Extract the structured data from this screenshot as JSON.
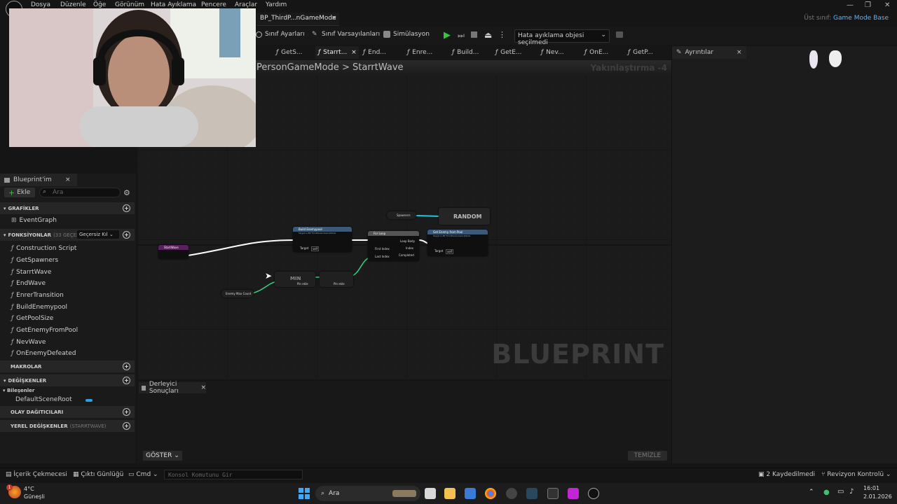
{
  "menu": [
    "Dosya",
    "Düzenle",
    "Öğe",
    "Görünüm",
    "Hata Ayıklama",
    "Pencere",
    "Araçlar",
    "Yardım"
  ],
  "doc_tab": {
    "label": "BP_ThirdP...nGameMode"
  },
  "parent_class": {
    "prefix": "Üst sınıf:",
    "name": "Game Mode Base"
  },
  "toolbar": {
    "class_settings": "Sınıf Ayarları",
    "class_defaults": "Sınıf Varsayılanları",
    "simulation": "Simülasyon",
    "debug_object": "Hata ayıklama objesi seçilmedi"
  },
  "fn_tabs": [
    "GetS...",
    "Starrt...",
    "End...",
    "Enre...",
    "Build...",
    "GetE...",
    "Nev...",
    "OnE...",
    "GetP..."
  ],
  "details_tab": "Ayrıntılar",
  "graph": {
    "breadcrumb_root": "PersonGameMode",
    "breadcrumb_sep": ">",
    "breadcrumb_leaf": "StarrtWave",
    "zoom": "Yakınlaştırma -4",
    "watermark": "BLUEPRINT",
    "nodes": {
      "start": "StartWave",
      "build": "Build Enemypool",
      "build_sub": "Target is BP ThirdPersonGameMode",
      "for_loop": "For Loop",
      "get_enemy": "Get Enemy from Pool",
      "get_enemy_sub": "Target is BP ThirdPersonGameMode",
      "spawners": "Spawners",
      "random": "RANDOM",
      "min": "MIN",
      "enemy_max_count": "Enemy Max Count",
      "pin_add": "Pin ekle",
      "target": "Target",
      "self": "self",
      "first_index": "First Index",
      "last_index": "Last Index",
      "loop_body": "Loop Body",
      "index": "Index",
      "completed": "Completed"
    }
  },
  "left_panel": {
    "tab": "Blueprint'im",
    "add": "Ekle",
    "search_placeholder": "Ara",
    "sections": {
      "graphs": "GRAFİKLER",
      "functions": "FONKSİYONLAR",
      "functions_count": "(33 GEÇERS",
      "override": "Geçersiz Kıl",
      "macros": "MAKROLAR",
      "variables": "DEĞİŞKENLER",
      "components": "Bileşenler",
      "dispatchers": "OLAY DAĞITICILARI",
      "local_vars": "YEREL DEĞİŞKENLER",
      "local_vars_scope": "(STARRTWAVE)"
    },
    "event_graph": "EventGraph",
    "functions": [
      "Construction Script",
      "GetSpawners",
      "StarrtWave",
      "EndWave",
      "EnrerTransition",
      "BuildEnemypool",
      "GetPoolSize",
      "GetEnemyFromPool",
      "NevWave",
      "OnEnemyDefeated"
    ],
    "component_item": "DefaultSceneRoot"
  },
  "compiler": {
    "tab": "Derleyici Sonuçları",
    "show": "GÖSTER",
    "clear": "TEMİZLE"
  },
  "statusbar": {
    "content_drawer": "İçerik Çekmecesi",
    "output_log": "Çıktı Günlüğü",
    "cmd": "Cmd",
    "console_placeholder": "Konsol Komutunu Gir",
    "saved": "2 Kaydedilmedi",
    "revision": "Revizyon Kontrolü"
  },
  "taskbar": {
    "weather_temp": "4°C",
    "weather_desc": "Güneşli",
    "weather_badge": "1",
    "search": "Ara",
    "time": "16:01",
    "date": "2.01.2026"
  },
  "colors": {
    "accent_blue": "#2f9fe0",
    "exec_white": "#ffffff",
    "pin_green": "#35d17e",
    "pin_cyan": "#20c8d8",
    "node_blue": "#3c5a78",
    "play_green": "#35c735"
  }
}
